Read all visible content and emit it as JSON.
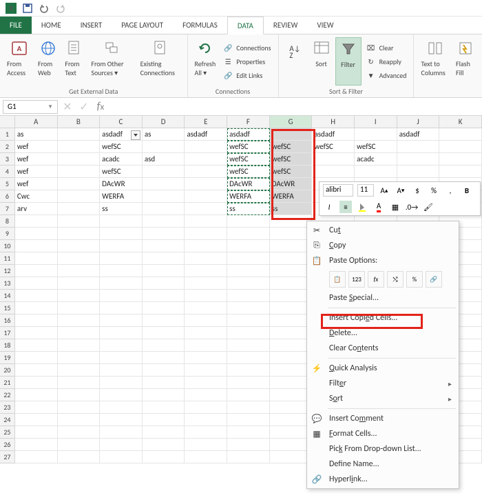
{
  "qat": {},
  "tabs": [
    "FILE",
    "HOME",
    "INSERT",
    "PAGE LAYOUT",
    "FORMULAS",
    "DATA",
    "REVIEW",
    "VIEW"
  ],
  "active_tab": "DATA",
  "ribbon": {
    "external": {
      "label": "Get External Data",
      "buttons": [
        "From Access",
        "From Web",
        "From Text",
        "From Other Sources ▾",
        "Existing Connections"
      ]
    },
    "connections": {
      "label": "Connections",
      "refresh": "Refresh All ▾",
      "items": [
        "Connections",
        "Properties",
        "Edit Links"
      ]
    },
    "sortfilter": {
      "label": "Sort & Filter",
      "sort": "Sort",
      "filter": "Filter",
      "items": [
        "Clear",
        "Reapply",
        "Advanced"
      ]
    },
    "datatools": {
      "textcol": "Text to Columns",
      "flash": "Flash Fill"
    }
  },
  "name_box": "G1",
  "columns": [
    "A",
    "B",
    "C",
    "D",
    "E",
    "F",
    "G",
    "H",
    "I",
    "J",
    "K"
  ],
  "rows": [
    1,
    2,
    3,
    4,
    5,
    6,
    7,
    8,
    9,
    10,
    11,
    12,
    13,
    14,
    15,
    16,
    17,
    18,
    19,
    20,
    21,
    22,
    23,
    24,
    25,
    26,
    27
  ],
  "cells": {
    "A1": "as",
    "C1": "asdadf",
    "D1": "as",
    "E1": "asdadf",
    "F1": "asdadf",
    "H1": "asdadf",
    "J1": "asdadf",
    "A2": "wef",
    "C2": "wefSC",
    "F2": "wefSC",
    "G2": "wefSC",
    "H2": "wefSC",
    "I2": "wefSC",
    "A3": "wef",
    "C3": "acadc",
    "D3": "asd",
    "F3": "wefSC",
    "G3": "wefSC",
    "I3": "acadc",
    "A4": "wef",
    "C4": "wefSC",
    "F4": "wefSC",
    "G4": "wefSC",
    "A5": "wef",
    "C5": "DAcWR",
    "F5": "DAcWR",
    "G5": "DAcWR",
    "A6": "Cwc",
    "C6": "WERFA",
    "F6": "WERFA",
    "G6": "WERFA",
    "A7": "arv",
    "C7": "ss",
    "F7": "ss",
    "G7": "ss"
  },
  "mini_toolbar": {
    "font": "alibri",
    "size": "11"
  },
  "context_menu": {
    "cut": "Cut",
    "copy": "Copy",
    "paste_hdr": "Paste Options:",
    "paste_special": "Paste Special...",
    "insert_copied": "Insert Copied Cells...",
    "delete": "Delete...",
    "clear": "Clear Contents",
    "quick": "Quick Analysis",
    "filter": "Filter",
    "sort": "Sort",
    "comment": "Insert Comment",
    "format": "Format Cells...",
    "pick": "Pick From Drop-down List...",
    "define": "Define Name...",
    "hyperlink": "Hyperlink..."
  }
}
